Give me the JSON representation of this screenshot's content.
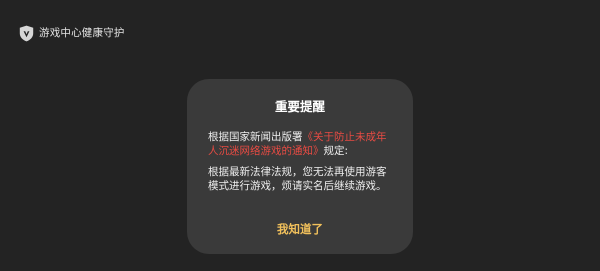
{
  "header": {
    "brand_label": "游戏中心健康守护",
    "brand_icon": "shield-icon"
  },
  "dialog": {
    "title": "重要提醒",
    "intro_prefix": "根据国家新闻出版署",
    "notice_title": "《关于防止未成年人沉迷网络游戏的通知》",
    "intro_suffix": "规定:",
    "message": "根据最新法律法规，您无法再使用游客模式进行游戏，烦请实名后继续游戏。",
    "confirm_label": "我知道了"
  },
  "colors": {
    "background": "#232323",
    "dialog_background": "#3a3a3a",
    "notice_link": "#e74b43",
    "confirm_text": "#f1c05b"
  }
}
